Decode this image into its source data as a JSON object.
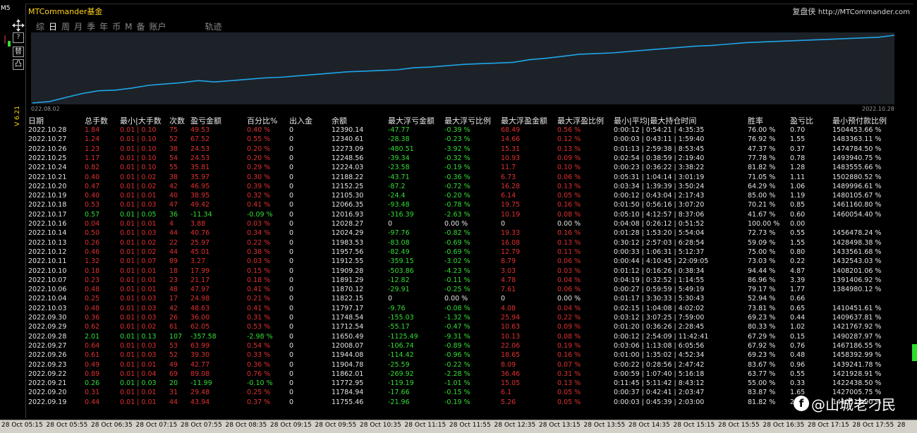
{
  "timeframe": "M5",
  "version": "V 6.21",
  "toolbar": {
    "help_label": "?",
    "btn1_label": "替",
    "btn2_label": "凸"
  },
  "app_title": "MTCommander基金",
  "corner": {
    "name": "复盘侠",
    "url": "http://MTCommander.com"
  },
  "tabs": [
    "综",
    "日",
    "周",
    "月",
    "季",
    "年",
    "币",
    "M",
    "备",
    "账户",
    "轨迹"
  ],
  "active_tab": "日",
  "chart": {
    "start_label": "022.08.02",
    "end_label": "2022.10.28",
    "line_color": "#1fa5e8",
    "bg_color": "#1d2229"
  },
  "chart_data": {
    "type": "line",
    "x_range": [
      "2022.08.02",
      "2022.10.28"
    ],
    "values": [
      0,
      2,
      8,
      14,
      18,
      19,
      22,
      26,
      28,
      30,
      33,
      31,
      33,
      35,
      37,
      38,
      40,
      42,
      44,
      46,
      47,
      48,
      49,
      52,
      53,
      55,
      57,
      58,
      59,
      60,
      64,
      66,
      69,
      72,
      73,
      74,
      76,
      78,
      80,
      82,
      84,
      85,
      87,
      89,
      90,
      91,
      92,
      93,
      94,
      95,
      96,
      97,
      100
    ]
  },
  "columns": [
    "日期",
    "总手数",
    "最小|大手数",
    "次数",
    "盈亏金额",
    "百分比%",
    "出入金",
    "余额",
    "最大浮亏金额",
    "最大浮亏比例",
    "最大浮盈金额",
    "最大浮盈比例",
    "最小|平均|最大持仓时间",
    "胜率",
    "盈亏比",
    "最小预付款比例"
  ],
  "rows": [
    [
      "2022.10.28",
      "1.84",
      "0.01 | 0.10",
      "75",
      "49.53",
      "0.40 %",
      "0",
      "12390.14",
      "-47.77",
      "-0.39 %",
      "68.49",
      "0.56 %",
      "0:00:12 | 0:54:21 | 4:35:35",
      "76.00 %",
      "0.70",
      "1504453.66 %"
    ],
    [
      "2022.10.27",
      "1.24",
      "0.01 | 0.10",
      "52",
      "67.52",
      "0.55 %",
      "0",
      "12340.61",
      "-28.38",
      "-0.23 %",
      "14.66",
      "0.12 %",
      "0:00:03 | 0:43:11 | 1:59:40",
      "76.92 %",
      "1.55",
      "1483363.11 %"
    ],
    [
      "2022.10.26",
      "1.23",
      "0.01 | 0.10",
      "38",
      "24.53",
      "0.20 %",
      "0",
      "12273.09",
      "-480.51",
      "-3.92 %",
      "15.31",
      "0.13 %",
      "0:01:13 | 2:59:38 | 8:53:45",
      "47.37 %",
      "0.37",
      "1474784.50 %"
    ],
    [
      "2022.10.25",
      "1.17",
      "0.01 | 0.10",
      "54",
      "24.53",
      "0.20 %",
      "0",
      "12248.56",
      "-39.34",
      "-0.32 %",
      "10.93",
      "0.09 %",
      "0:02:54 | 0:38:59 | 2:19:40",
      "77.78 %",
      "0.78",
      "1493940.75 %"
    ],
    [
      "2022.10.24",
      "0.82",
      "0.01 | 0.10",
      "55",
      "35.81",
      "0.29 %",
      "0",
      "12224.03",
      "-23.58",
      "-0.19 %",
      "11.7",
      "0.10 %",
      "0:00:23 | 0:36:22 | 3:38:22",
      "81.82 %",
      "1.28",
      "1483555.66 %"
    ],
    [
      "2022.10.21",
      "0.40",
      "0.01 | 0.02",
      "38",
      "35.97",
      "0.30 %",
      "0",
      "12188.22",
      "-43.71",
      "-0.36 %",
      "6.73",
      "0.06 %",
      "0:05:31 | 1:04:14 | 3:01:19",
      "71.05 %",
      "1.11",
      "1502880.52 %"
    ],
    [
      "2022.10.20",
      "0.47",
      "0.01 | 0.02",
      "42",
      "46.95",
      "0.39 %",
      "0",
      "12152.25",
      "-87.2",
      "-0.72 %",
      "16.28",
      "0.13 %",
      "0:03:34 | 1:39:39 | 3:50:24",
      "64.29 %",
      "1.06",
      "1489996.61 %"
    ],
    [
      "2022.10.19",
      "0.40",
      "0.01 | 0.01",
      "40",
      "38.95",
      "0.32 %",
      "0",
      "12105.30",
      "-24.4",
      "-0.20 %",
      "6.14",
      "0.05 %",
      "0:00:12 | 0:43:04 | 2:17:43",
      "85.00 %",
      "1.19",
      "1480105.67 %"
    ],
    [
      "2022.10.18",
      "0.53",
      "0.01 | 0.03",
      "47",
      "49.42",
      "0.41 %",
      "0",
      "12066.35",
      "-93.48",
      "-0.78 %",
      "19.75",
      "0.16 %",
      "0:01:50 | 0:56:16 | 3:07:20",
      "70.21 %",
      "0.85",
      "1461160.80 %"
    ],
    [
      "2022.10.17",
      "0.57",
      "0.01 | 0.05",
      "36",
      "-11.34",
      "-0.09 %",
      "0",
      "12016.93",
      "-316.39",
      "-2.63 %",
      "10.19",
      "0.08 %",
      "0:05:10 | 4:12:57 | 8:37:06",
      "41.67 %",
      "0.60",
      "1460054.40 %"
    ],
    [
      "2022.10.16",
      "0.04",
      "0.01 | 0.01",
      "4",
      "3.88",
      "0.03 %",
      "0",
      "12028.27",
      "0",
      "0.00 %",
      "0",
      "0.00 %",
      "0:04:08 | 0:26:12 | 0:51:52",
      "100.00 %",
      "0.00",
      ""
    ],
    [
      "2022.10.14",
      "0.50",
      "0.01 | 0.03",
      "44",
      "40.76",
      "0.34 %",
      "0",
      "12024.29",
      "-97.76",
      "-0.82 %",
      "19.33",
      "0.16 %",
      "0:01:28 | 1:53:20 | 5:54:04",
      "72.73 %",
      "0.55",
      "1456478.24 %"
    ],
    [
      "2022.10.13",
      "0.26",
      "0.01 | 0.02",
      "22",
      "25.97",
      "0.22 %",
      "0",
      "11983.53",
      "-83.08",
      "-0.69 %",
      "16.08",
      "0.13 %",
      "0:30:12 | 2:57:03 | 6:28:54",
      "59.09 %",
      "1.55",
      "1428498.38 %"
    ],
    [
      "2022.10.12",
      "0.46",
      "0.01 | 0.02",
      "44",
      "45.01",
      "0.38 %",
      "0",
      "11957.56",
      "-82.49",
      "-0.69 %",
      "12.79",
      "0.11 %",
      "0:00:33 | 1:06:31 | 5:12:37",
      "75.00 %",
      "0.80",
      "1433561.68 %"
    ],
    [
      "2022.10.11",
      "1.32",
      "0.01 | 0.07",
      "89",
      "3.27",
      "0.03 %",
      "0",
      "11912.55",
      "-359.15",
      "-3.02 %",
      "8.79",
      "0.06 %",
      "0:00:44 | 4:10:45 | 22:09:05",
      "73.03 %",
      "0.22",
      "1432543.03 %"
    ],
    [
      "2022.10.10",
      "0.18",
      "0.01 | 0.01",
      "18",
      "17.99",
      "0.15 %",
      "0",
      "11909.28",
      "-503.86",
      "-4.23 %",
      "3.03",
      "0.03 %",
      "0:01:12 | 0:16:26 | 0:38:34",
      "94.44 %",
      "4.87",
      "1408201.06 %"
    ],
    [
      "2022.10.07",
      "0.23",
      "0.01 | 0.01",
      "23",
      "21.17",
      "0.18 %",
      "0",
      "11891.29",
      "-12.82",
      "-0.11 %",
      "4.78",
      "0.04 %",
      "0:04:19 | 0:32:52 | 1:14:55",
      "86.96 %",
      "3.39",
      "1391406.92 %"
    ],
    [
      "2022.10.06",
      "0.48",
      "0.01 | 0.01",
      "48",
      "47.97",
      "0.41 %",
      "0",
      "11870.12",
      "-29.91",
      "-0.25 %",
      "7.61",
      "0.06 %",
      "0:00:27 | 0:59:59 | 5:49:19",
      "79.17 %",
      "1.77",
      "1384980.12 %"
    ],
    [
      "2022.10.04",
      "0.25",
      "0.01 | 0.03",
      "17",
      "24.98",
      "0.21 %",
      "0",
      "11822.15",
      "0",
      "0.00 %",
      "0",
      "0.00 %",
      "0:01:17 | 3:30:33 | 5:30:43",
      "52.94 %",
      "0.66",
      ""
    ],
    [
      "2022.10.03",
      "0.48",
      "0.01 | 0.03",
      "42",
      "48.63",
      "0.41 %",
      "0",
      "11797.17",
      "-9.76",
      "-0.08 %",
      "4.08",
      "0.04 %",
      "0:02:15 | 1:04:08 | 4:02:02",
      "73.81 %",
      "0.65",
      "1410451.61 %"
    ],
    [
      "2022.09.30",
      "0.36",
      "0.01 | 0.03",
      "26",
      "36.00",
      "0.31 %",
      "0",
      "11748.54",
      "-155.03",
      "-1.32 %",
      "25.94",
      "0.22 %",
      "0:03:12 | 3:07:25 | 7:59:00",
      "69.23 %",
      "0.44",
      "1409637.81 %"
    ],
    [
      "2022.09.29",
      "0.62",
      "0.01 | 0.02",
      "61",
      "62.05",
      "0.53 %",
      "0",
      "11712.54",
      "-55.17",
      "-0.47 %",
      "10.63",
      "0.09 %",
      "0:01:20 | 0:36:26 | 2:28:45",
      "80.33 %",
      "1.02",
      "1421767.92 %"
    ],
    [
      "2022.09.28",
      "2.01",
      "0.01 | 0.13",
      "107",
      "-357.58",
      "-2.98 %",
      "0",
      "11650.49",
      "-1125.49",
      "-9.31 %",
      "10.13",
      "0.08 %",
      "0:00:12 | 2:54:09 | 11:42:41",
      "67.29 %",
      "0.15",
      "1490287.97 %"
    ],
    [
      "2022.09.27",
      "0.64",
      "0.01 | 0.03",
      "53",
      "63.99",
      "0.54 %",
      "0",
      "12008.07",
      "-106.74",
      "-0.89 %",
      "22.06",
      "0.19 %",
      "0:03:06 | 1:13:08 | 6:05:56",
      "67.92 %",
      "0.76",
      "1467186.55 %"
    ],
    [
      "2022.09.26",
      "0.61",
      "0.01 | 0.03",
      "52",
      "39.30",
      "0.33 %",
      "0",
      "11944.08",
      "-114.42",
      "-0.96 %",
      "18.65",
      "0.16 %",
      "0:01:00 | 1:35:02 | 4:52:34",
      "69.23 %",
      "0.48",
      "1458392.99 %"
    ],
    [
      "2022.09.23",
      "0.49",
      "0.01 | 0.01",
      "49",
      "42.77",
      "0.36 %",
      "0",
      "11904.78",
      "-25.59",
      "-0.22 %",
      "8.09",
      "0.07 %",
      "0:00:22 | 0:28:56 | 2:47:42",
      "83.67 %",
      "0.96",
      "1439241.78 %"
    ],
    [
      "2022.09.22",
      "0.89",
      "0.01 | 0.04",
      "69",
      "89.08",
      "0.76 %",
      "0",
      "11862.01",
      "-269.92",
      "-2.28 %",
      "36.46",
      "0.31 %",
      "0:00:59 | 1:07:40 | 5:16:18",
      "63.77 %",
      "0.55",
      "1421928.91 %"
    ],
    [
      "2022.09.21",
      "0.26",
      "0.01 | 0.03",
      "20",
      "-11.99",
      "-0.10 %",
      "0",
      "11772.95",
      "-119.19",
      "-1.01 %",
      "15.05",
      "0.13 %",
      "0:11:45 | 5:11:42 | 8:43:12",
      "55.00 %",
      "0.33",
      "1422438.50 %"
    ],
    [
      "2022.09.20",
      "0.31",
      "0.01 | 0.01",
      "31",
      "29.48",
      "0.25 %",
      "0",
      "11784.94",
      "-17.66",
      "-0.15 %",
      "6.1",
      "0.05 %",
      "0:00:37 | 0:42:41 | 2:03:47",
      "83.87 %",
      "1.65",
      "1427005.75 %"
    ],
    [
      "2022.09.19",
      "0.44",
      "0.01 | 0.01",
      "44",
      "43.94",
      "0.37 %",
      "0",
      "11755.46",
      "-21.96",
      "-0.19 %",
      "5.26",
      "0.05 %",
      "0:00:03 | 0:45:39 | 2:03:00",
      "81.82 %",
      "2.12",
      "1410513.90 %"
    ]
  ],
  "time_axis": [
    "28 Oct 05:15",
    "28 Oct 05:55",
    "28 Oct 06:35",
    "28 Oct 07:15",
    "28 Oct 07:55",
    "28 Oct 08:35",
    "28 Oct 09:15",
    "28 Oct 09:55",
    "28 Oct 10:35",
    "28 Oct 11:15",
    "28 Oct 11:55",
    "28 Oct 12:35",
    "28 Oct 13:15",
    "28 Oct 13:55",
    "28 Oct 14:35",
    "28 Oct 15:15",
    "28 Oct 15:55",
    "28 Oct 16:35",
    "28 Oct 17:15",
    "28 Oct 17:55",
    "28"
  ],
  "watermark": "@山城老刁民",
  "colors": {
    "profit": "#e03030",
    "loss": "#33dd33",
    "neutral": "#e4e4e4",
    "title": "#ffd21a"
  }
}
